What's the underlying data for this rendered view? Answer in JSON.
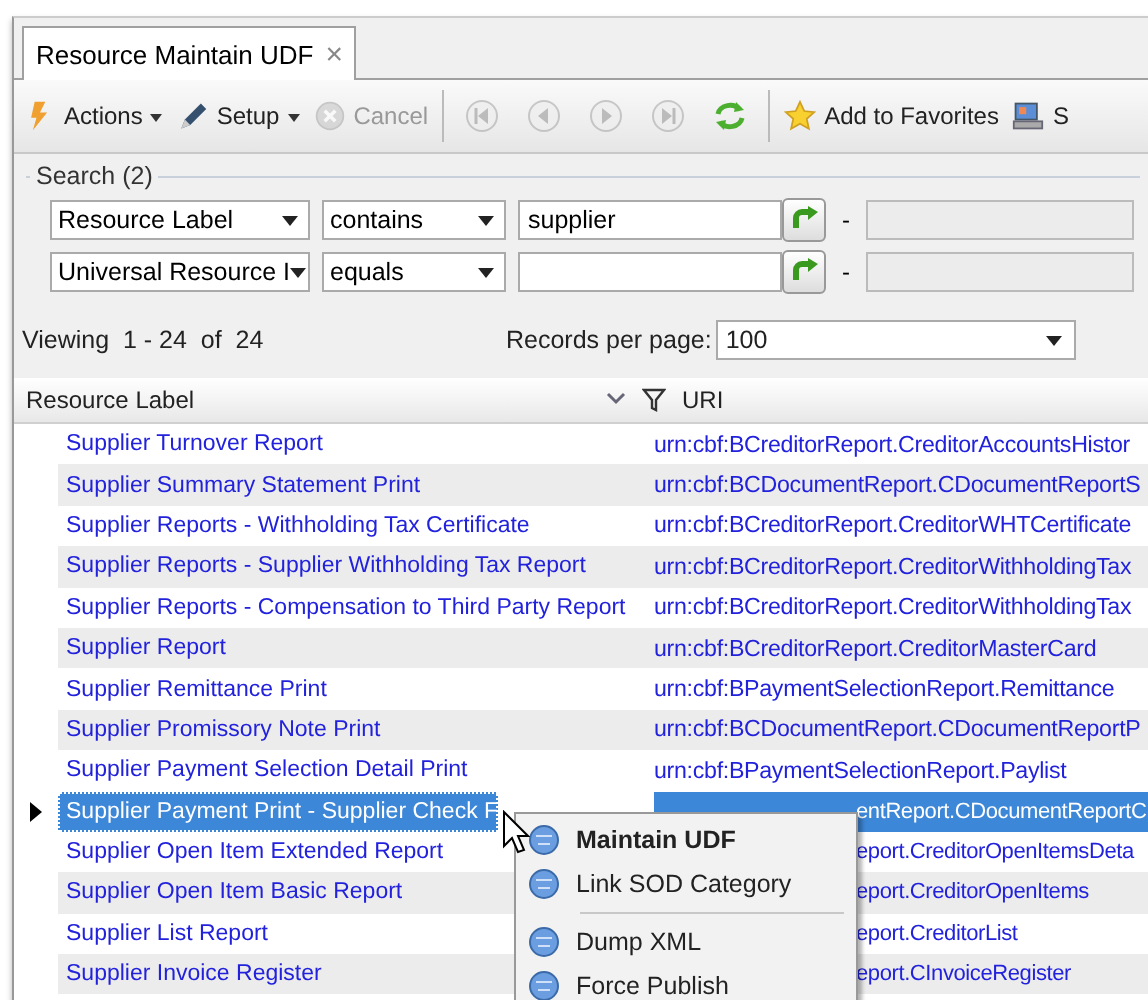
{
  "tab": {
    "title": "Resource Maintain UDF",
    "close": "×",
    "selected": true
  },
  "toolbar": [
    {
      "kind": "dropdown",
      "label": "Actions",
      "disabled": false
    },
    {
      "kind": "dropdown",
      "label": "Setup",
      "disabled": false
    },
    {
      "kind": "button",
      "label": "Cancel",
      "disabled": true
    },
    {
      "kind": "separator"
    },
    {
      "kind": "icon",
      "disabled": true
    },
    {
      "kind": "icon",
      "disabled": true
    },
    {
      "kind": "icon",
      "disabled": true
    },
    {
      "kind": "icon",
      "disabled": true
    },
    {
      "kind": "icon",
      "disabled": false
    },
    {
      "kind": "separator"
    },
    {
      "kind": "button",
      "label": "Add to Favorites",
      "disabled": false
    },
    {
      "kind": "button",
      "label": "S",
      "disabled": false
    }
  ],
  "search": {
    "title": "Search (2)",
    "criteria": [
      {
        "field": "Resource Label",
        "operator": "contains",
        "value": "supplier",
        "dash": "-"
      },
      {
        "field": "Universal Resource I",
        "operator": "equals",
        "dash": "-"
      }
    ]
  },
  "paging": {
    "viewing": "Viewing  1 - 24  of  24",
    "records_label": "Records per page:",
    "records_value": "100"
  },
  "table": {
    "columns": [
      "Resource Label",
      "URI"
    ],
    "rows": [
      {
        "label": "Supplier Turnover Report",
        "uri": "urn:cbf:BCreditorReport.CreditorAccountsHistor",
        "selected": false
      },
      {
        "label": "Supplier Summary Statement Print",
        "uri": "urn:cbf:BCDocumentReport.CDocumentReportS",
        "selected": false
      },
      {
        "label": "Supplier Reports - Withholding Tax Certificate",
        "uri": "urn:cbf:BCreditorReport.CreditorWHTCertificate",
        "selected": false
      },
      {
        "label": "Supplier Reports - Supplier Withholding Tax Report",
        "uri": "urn:cbf:BCreditorReport.CreditorWithholdingTax",
        "selected": false
      },
      {
        "label": "Supplier Reports - Compensation to Third Party Report",
        "uri": "urn:cbf:BCreditorReport.CreditorWithholdingTax",
        "selected": false
      },
      {
        "label": "Supplier Report",
        "uri": "urn:cbf:BCreditorReport.CreditorMasterCard",
        "selected": false
      },
      {
        "label": "Supplier Remittance Print",
        "uri": "urn:cbf:BPaymentSelectionReport.Remittance",
        "selected": false
      },
      {
        "label": "Supplier Promissory Note Print",
        "uri": "urn:cbf:BCDocumentReport.CDocumentReportP",
        "selected": false
      },
      {
        "label": "Supplier Payment Selection Detail Print",
        "uri": "urn:cbf:BPaymentSelectionReport.Paylist",
        "selected": false
      },
      {
        "label": "Supplier Payment Print - Supplier Check F",
        "uri": "entReport.CDocumentReportC",
        "selected": true
      },
      {
        "label": "Supplier Open Item Extended Report",
        "uri": "eport.CreditorOpenItemsDeta",
        "selected": false
      },
      {
        "label": "Supplier Open Item Basic Report",
        "uri": "eport.CreditorOpenItems",
        "selected": false
      },
      {
        "label": "Supplier List Report",
        "uri": "eport.CreditorList",
        "selected": false
      },
      {
        "label": "Supplier Invoice Register",
        "uri": "eport.CInvoiceRegister",
        "selected": false
      }
    ]
  },
  "context_menu": {
    "items": [
      {
        "kind": "item",
        "label": "Maintain UDF",
        "default": true
      },
      {
        "kind": "item",
        "label": "Link SOD Category",
        "default": false
      },
      {
        "kind": "separator"
      },
      {
        "kind": "item",
        "label": "Dump XML",
        "default": false
      },
      {
        "kind": "item",
        "label": "Force Publish",
        "default": false
      }
    ]
  }
}
